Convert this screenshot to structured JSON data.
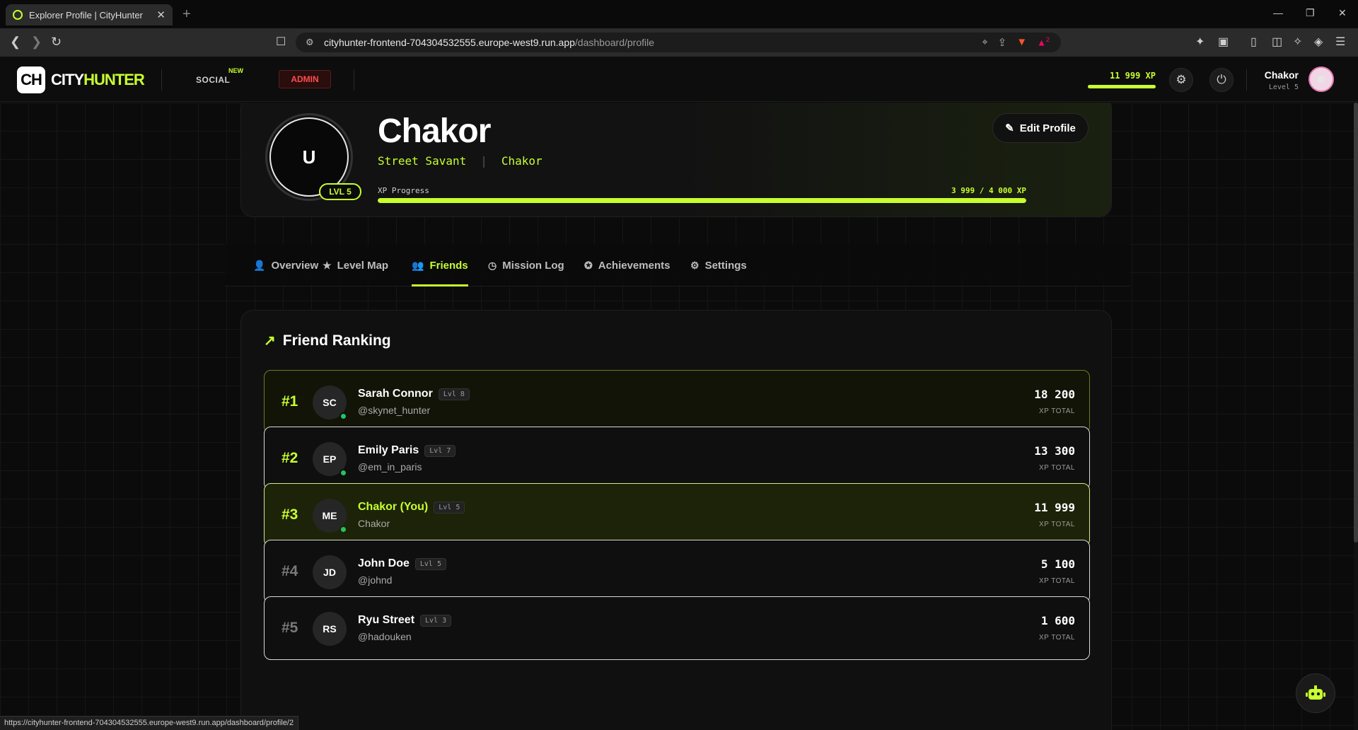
{
  "browser": {
    "tab_title": "Explorer Profile | CityHunter",
    "url_host": "cityhunter-frontend-704304532555.europe-west9.run.app",
    "url_path": "/dashboard/profile",
    "status_url": "https://cityhunter-frontend-704304532555.europe-west9.run.app/dashboard/profile/2",
    "brave_badge": "2"
  },
  "header": {
    "logo_box": "CH",
    "logo_text_a": "CITY",
    "logo_text_b": "HUNTER",
    "social_label": "SOCIAL",
    "new_badge": "NEW",
    "admin_label": "ADMIN",
    "xp_text": "11 999 XP",
    "xp_progress": 0.9998,
    "user_name": "Chakor",
    "user_level": "Level 5"
  },
  "profile": {
    "avatar_letter": "U",
    "level_badge": "LVL 5",
    "name": "Chakor",
    "title": "Street Savant",
    "separator": "|",
    "username": "Chakor",
    "xp_label": "XP Progress",
    "xp_value": "3 999 / 4 000 XP",
    "xp_progress": 0.99975,
    "edit_label": "Edit Profile"
  },
  "tabs": [
    {
      "label": "Overview",
      "icon": "user-icon"
    },
    {
      "label": "Level Map",
      "icon": "star-icon"
    },
    {
      "label": "Friends",
      "icon": "users-icon"
    },
    {
      "label": "Mission Log",
      "icon": "clock-icon"
    },
    {
      "label": "Achievements",
      "icon": "award-icon"
    },
    {
      "label": "Settings",
      "icon": "gear-icon"
    }
  ],
  "ranking": {
    "title": "Friend Ranking",
    "xp_caption": "XP TOTAL",
    "rows": [
      {
        "rank": "#1",
        "initials": "SC",
        "name": "Sarah Connor",
        "level": "Lvl 8",
        "handle": "@skynet_hunter",
        "xp": "18 200",
        "online": true
      },
      {
        "rank": "#2",
        "initials": "EP",
        "name": "Emily Paris",
        "level": "Lvl 7",
        "handle": "@em_in_paris",
        "xp": "13 300",
        "online": true
      },
      {
        "rank": "#3",
        "initials": "ME",
        "name": "Chakor (You)",
        "level": "Lvl 5",
        "handle": "Chakor",
        "xp": "11 999",
        "online": true
      },
      {
        "rank": "#4",
        "initials": "JD",
        "name": "John Doe",
        "level": "Lvl 5",
        "handle": "@johnd",
        "xp": "5 100",
        "online": false
      },
      {
        "rank": "#5",
        "initials": "RS",
        "name": "Ryu Street",
        "level": "Lvl 3",
        "handle": "@hadouken",
        "xp": "1 600",
        "online": false
      }
    ]
  },
  "colors": {
    "accent": "#c8ff2f",
    "admin": "#ff4d4d",
    "online": "#22c55e"
  }
}
